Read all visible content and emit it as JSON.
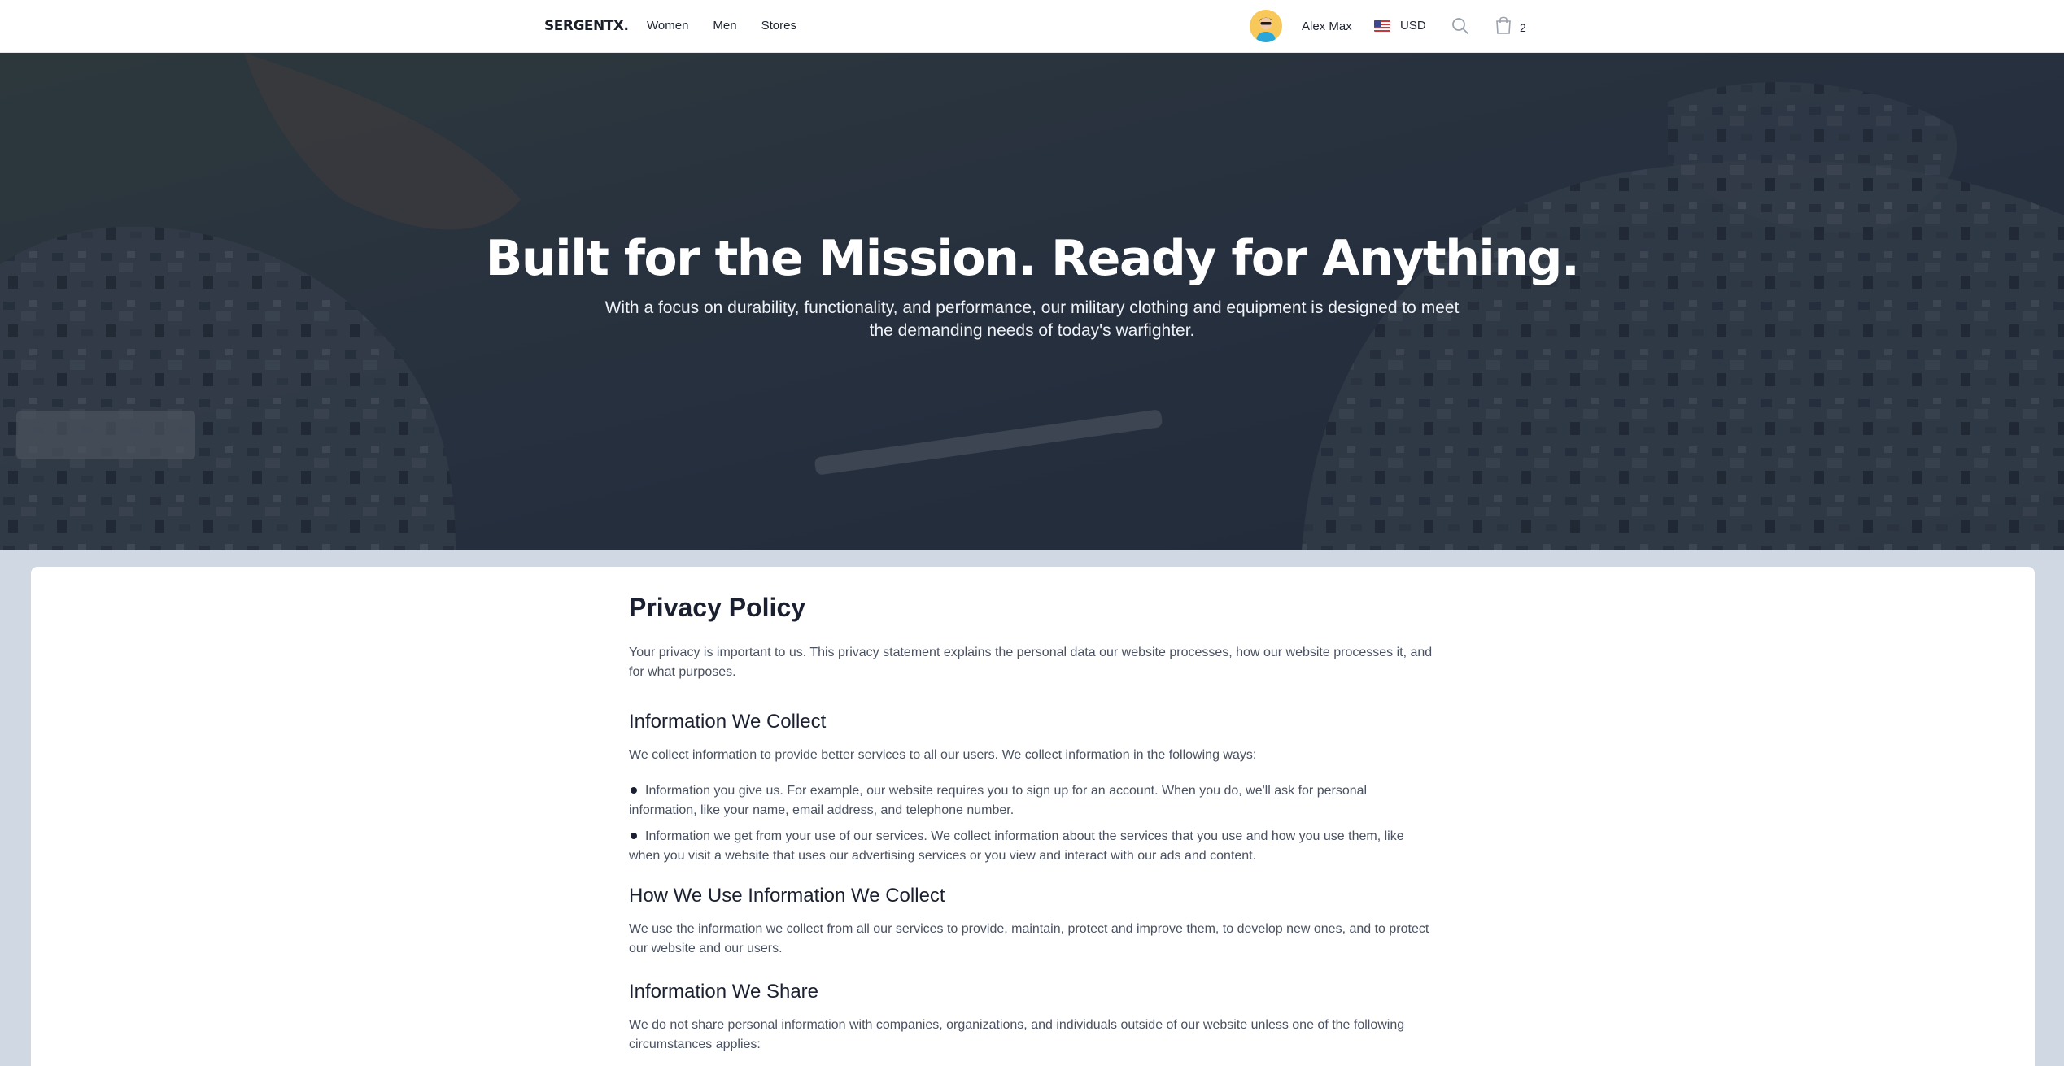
{
  "header": {
    "logo": "SERGENTX.",
    "nav": [
      "Women",
      "Men",
      "Stores"
    ],
    "user_name": "Alex Max",
    "currency": "USD",
    "cart_count": "2"
  },
  "hero": {
    "title": "Built for the Mission. Ready for Anything.",
    "subtitle": "With a focus on durability, functionality, and performance, our military clothing and equipment is designed to meet the demanding needs of today's warfighter."
  },
  "policy": {
    "title": "Privacy Policy",
    "intro": "Your privacy is important to us. This privacy statement explains the personal data our website processes, how our website processes it, and for what purposes.",
    "sections": [
      {
        "heading": "Information We Collect",
        "body": "We collect information to provide better services to all our users. We collect information in the following ways:",
        "items": [
          "Information you give us. For example, our website requires you to sign up for an account. When you do, we'll ask for personal information, like your name, email address, and telephone number.",
          "Information we get from your use of our services. We collect information about the services that you use and how you use them, like when you visit a website that uses our advertising services or you view and interact with our ads and content."
        ]
      },
      {
        "heading": "How We Use Information We Collect",
        "body": "We use the information we collect from all our services to provide, maintain, protect and improve them, to develop new ones, and to protect our website and our users."
      },
      {
        "heading": "Information We Share",
        "body": "We do not share personal information with companies, organizations, and individuals outside of our website unless one of the following circumstances applies:"
      }
    ]
  },
  "colors": {
    "page_background": "#cfd8e3",
    "hero_overlay": "#161e2c",
    "text_primary": "#1b2030",
    "text_body": "#4a5160"
  },
  "icons": [
    "avatar-icon",
    "us-flag-icon",
    "search-icon",
    "shopping-bag-icon"
  ]
}
